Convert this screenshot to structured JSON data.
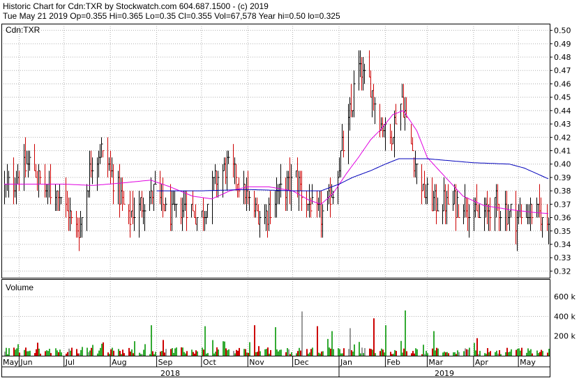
{
  "header": {
    "line1": "Historic Chart for Cdn:TXR by Stockwatch.com 604.687.1500 - (c) 2019",
    "line2": "Tue May 21 2019  Op=0.355  Hi=0.365  Lo=0.35  Cl=0.355  Vol=67,578  Year hi=0.50  lo=0.325"
  },
  "colors": {
    "up": "#000000",
    "down": "#cc0000",
    "ma_short": "#e000e0",
    "ma_long": "#0000bb",
    "vol_up": "#33aa33",
    "vol_down": "#cc0000",
    "vol_flat": "#999999",
    "grid": "#b0b0b0"
  },
  "chart_data": [
    {
      "type": "ohlc",
      "title": "Cdn:TXR",
      "ylim": [
        0.315,
        0.505
      ],
      "y_ticks": [
        "0.50",
        "0.49",
        "0.48",
        "0.47",
        "0.46",
        "0.45",
        "0.44",
        "0.43",
        "0.42",
        "0.41",
        "0.40",
        "0.39",
        "0.38",
        "0.37",
        "0.36",
        "0.35",
        "0.34",
        "0.33",
        "0.32"
      ],
      "x_months": [
        "May",
        "Jun",
        "Jul",
        "Aug",
        "Sep",
        "Oct",
        "Nov",
        "Dec",
        "Jan",
        "Feb",
        "Mar",
        "Apr",
        "May"
      ],
      "x_years": [
        "2018",
        "2019"
      ],
      "grid": true,
      "anchors": [
        [
          "2018-05-22",
          0.38
        ],
        [
          "2018-05-30",
          0.39
        ],
        [
          "2018-06-08",
          0.4
        ],
        [
          "2018-06-18",
          0.38
        ],
        [
          "2018-06-27",
          0.38
        ],
        [
          "2018-07-05",
          0.36
        ],
        [
          "2018-07-11",
          0.35
        ],
        [
          "2018-07-19",
          0.4
        ],
        [
          "2018-07-26",
          0.41
        ],
        [
          "2018-08-03",
          0.39
        ],
        [
          "2018-08-13",
          0.36
        ],
        [
          "2018-08-22",
          0.37
        ],
        [
          "2018-08-31",
          0.38
        ],
        [
          "2018-09-10",
          0.36
        ],
        [
          "2018-09-20",
          0.37
        ],
        [
          "2018-10-01",
          0.36
        ],
        [
          "2018-10-11",
          0.39
        ],
        [
          "2018-10-18",
          0.4
        ],
        [
          "2018-10-25",
          0.39
        ],
        [
          "2018-11-02",
          0.37
        ],
        [
          "2018-11-12",
          0.36
        ],
        [
          "2018-11-22",
          0.38
        ],
        [
          "2018-12-03",
          0.39
        ],
        [
          "2018-12-12",
          0.37
        ],
        [
          "2018-12-20",
          0.36
        ],
        [
          "2018-12-28",
          0.38
        ],
        [
          "2019-01-07",
          0.43
        ],
        [
          "2019-01-14",
          0.47
        ],
        [
          "2019-01-22",
          0.46
        ],
        [
          "2019-01-29",
          0.43
        ],
        [
          "2019-02-04",
          0.42
        ],
        [
          "2019-02-12",
          0.45
        ],
        [
          "2019-02-19",
          0.41
        ],
        [
          "2019-02-26",
          0.38
        ],
        [
          "2019-03-06",
          0.37
        ],
        [
          "2019-03-15",
          0.37
        ],
        [
          "2019-03-26",
          0.37
        ],
        [
          "2019-04-05",
          0.36
        ],
        [
          "2019-04-16",
          0.37
        ],
        [
          "2019-04-29",
          0.36
        ],
        [
          "2019-05-10",
          0.365
        ],
        [
          "2019-05-21",
          0.355
        ]
      ],
      "ma_short": [
        [
          "2018-05-22",
          0.385
        ],
        [
          "2018-06-15",
          0.385
        ],
        [
          "2018-07-01",
          0.385
        ],
        [
          "2018-07-20",
          0.384
        ],
        [
          "2018-08-10",
          0.386
        ],
        [
          "2018-08-28",
          0.388
        ],
        [
          "2018-09-10",
          0.383
        ],
        [
          "2018-09-25",
          0.376
        ],
        [
          "2018-10-08",
          0.374
        ],
        [
          "2018-10-20",
          0.38
        ],
        [
          "2018-11-01",
          0.383
        ],
        [
          "2018-11-15",
          0.383
        ],
        [
          "2018-12-01",
          0.38
        ],
        [
          "2018-12-12",
          0.373
        ],
        [
          "2018-12-20",
          0.37
        ],
        [
          "2018-12-28",
          0.378
        ],
        [
          "2019-01-06",
          0.393
        ],
        [
          "2019-01-14",
          0.405
        ],
        [
          "2019-01-22",
          0.418
        ],
        [
          "2019-01-29",
          0.426
        ],
        [
          "2019-02-06",
          0.437
        ],
        [
          "2019-02-13",
          0.44
        ],
        [
          "2019-02-22",
          0.425
        ],
        [
          "2019-03-01",
          0.405
        ],
        [
          "2019-03-10",
          0.394
        ],
        [
          "2019-03-25",
          0.376
        ],
        [
          "2019-04-08",
          0.369
        ],
        [
          "2019-04-25",
          0.366
        ],
        [
          "2019-05-10",
          0.364
        ],
        [
          "2019-05-21",
          0.363
        ]
      ],
      "ma_long": [
        [
          "2018-09-01",
          0.38
        ],
        [
          "2018-10-01",
          0.38
        ],
        [
          "2018-11-01",
          0.381
        ],
        [
          "2018-12-01",
          0.38
        ],
        [
          "2018-12-20",
          0.38
        ],
        [
          "2019-01-01",
          0.385
        ],
        [
          "2019-01-10",
          0.39
        ],
        [
          "2019-01-22",
          0.395
        ],
        [
          "2019-02-01",
          0.4
        ],
        [
          "2019-02-10",
          0.404
        ],
        [
          "2019-03-01",
          0.404
        ],
        [
          "2019-04-01",
          0.401
        ],
        [
          "2019-04-25",
          0.4
        ],
        [
          "2019-05-05",
          0.397
        ],
        [
          "2019-05-21",
          0.389
        ]
      ]
    },
    {
      "type": "bar",
      "title": "Volume",
      "ylim": [
        0,
        750000
      ],
      "y_ticks": [
        "600 k",
        "400 k",
        "200 k"
      ],
      "grid": true,
      "spikes": [
        [
          "2018-07-20",
          110000
        ],
        [
          "2018-08-28",
          310000
        ],
        [
          "2018-09-05",
          160000
        ],
        [
          "2018-10-03",
          300000
        ],
        [
          "2018-10-13",
          300000
        ],
        [
          "2018-10-20",
          700000
        ],
        [
          "2018-11-05",
          310000
        ],
        [
          "2018-11-19",
          290000
        ],
        [
          "2018-12-07",
          450000
        ],
        [
          "2018-12-17",
          300000
        ],
        [
          "2018-12-27",
          250000
        ],
        [
          "2019-01-08",
          280000
        ],
        [
          "2019-01-14",
          140000
        ],
        [
          "2019-01-24",
          380000
        ],
        [
          "2019-02-01",
          310000
        ],
        [
          "2019-02-14",
          460000
        ],
        [
          "2019-03-05",
          250000
        ],
        [
          "2019-04-01",
          130000
        ]
      ]
    }
  ]
}
